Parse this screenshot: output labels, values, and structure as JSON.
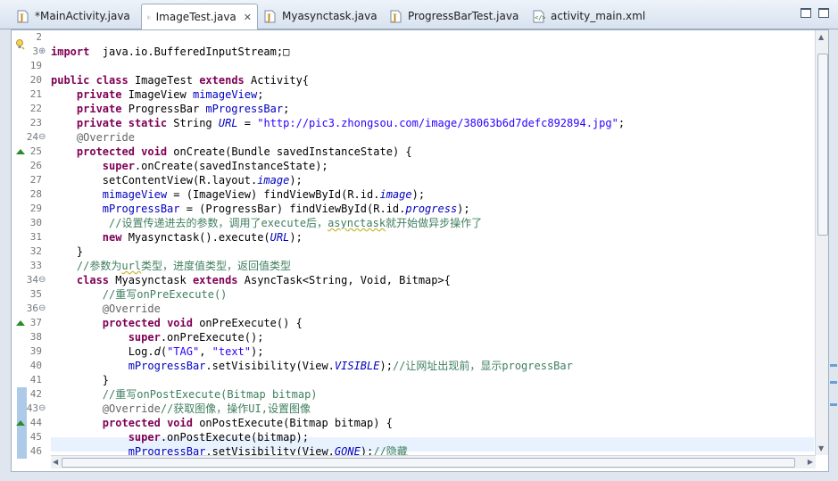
{
  "tabs": [
    {
      "label": "*MainActivity.java",
      "icon": "java-file-icon",
      "active": false
    },
    {
      "label": "ImageTest.java",
      "icon": "java-file-icon",
      "active": true
    },
    {
      "label": "Myasynctask.java",
      "icon": "java-file-icon",
      "active": false
    },
    {
      "label": "ProgressBarTest.java",
      "icon": "java-file-icon",
      "active": false
    },
    {
      "label": "activity_main.xml",
      "icon": "xml-file-icon",
      "active": false
    }
  ],
  "gutter": {
    "line_numbers": [
      "2",
      "3",
      "19",
      "20",
      "21",
      "22",
      "23",
      "24",
      "25",
      "26",
      "27",
      "28",
      "29",
      "30",
      "31",
      "32",
      "33",
      "34",
      "35",
      "36",
      "37",
      "38",
      "39",
      "40",
      "41",
      "42",
      "43",
      "44",
      "45",
      "46"
    ]
  },
  "code_lines": [
    [],
    [
      [
        "kw",
        "import"
      ],
      [
        "",
        "  java.io.BufferedInputStream;"
      ],
      [
        "",
        "□"
      ]
    ],
    [],
    [
      [
        "kw",
        "public"
      ],
      [
        "",
        " "
      ],
      [
        "kw",
        "class"
      ],
      [
        "",
        " ImageTest "
      ],
      [
        "kw",
        "extends"
      ],
      [
        "",
        " Activity{"
      ]
    ],
    [
      [
        "",
        "    "
      ],
      [
        "kw",
        "private"
      ],
      [
        "",
        " ImageView "
      ],
      [
        "fld",
        "mimageView"
      ],
      [
        "",
        ";"
      ]
    ],
    [
      [
        "",
        "    "
      ],
      [
        "kw",
        "private"
      ],
      [
        "",
        " ProgressBar "
      ],
      [
        "fld",
        "mProgressBar"
      ],
      [
        "",
        ";"
      ]
    ],
    [
      [
        "",
        "    "
      ],
      [
        "kw",
        "private"
      ],
      [
        "",
        " "
      ],
      [
        "kw",
        "static"
      ],
      [
        "",
        " String "
      ],
      [
        "ifld",
        "URL"
      ],
      [
        "",
        " = "
      ],
      [
        "str",
        "\"http://pic3.zhongsou.com/image/38063b6d7defc892894.jpg\""
      ],
      [
        "",
        ";"
      ]
    ],
    [
      [
        "",
        "    "
      ],
      [
        "ann",
        "@Override"
      ]
    ],
    [
      [
        "",
        "    "
      ],
      [
        "kw",
        "protected"
      ],
      [
        "",
        " "
      ],
      [
        "kw",
        "void"
      ],
      [
        "",
        " onCreate(Bundle savedInstanceState) {"
      ]
    ],
    [
      [
        "",
        "        "
      ],
      [
        "kw",
        "super"
      ],
      [
        "",
        ".onCreate(savedInstanceState);"
      ]
    ],
    [
      [
        "",
        "        setContentView(R.layout."
      ],
      [
        "ifld",
        "image"
      ],
      [
        "",
        ");"
      ]
    ],
    [
      [
        "",
        "        "
      ],
      [
        "fld",
        "mimageView"
      ],
      [
        "",
        " = (ImageView) findViewById(R.id."
      ],
      [
        "ifld",
        "image"
      ],
      [
        "",
        ");"
      ]
    ],
    [
      [
        "",
        "        "
      ],
      [
        "fld",
        "mProgressBar"
      ],
      [
        "",
        " = (ProgressBar) findViewById(R.id."
      ],
      [
        "ifld",
        "progress"
      ],
      [
        "",
        ");"
      ]
    ],
    [
      [
        "",
        "         "
      ],
      [
        "cmt",
        "//设置传递进去的参数，调用了execute后，"
      ],
      [
        "cmtsq",
        "asynctask"
      ],
      [
        "cmt",
        "就开始做异步操作了"
      ]
    ],
    [
      [
        "",
        "        "
      ],
      [
        "kw",
        "new"
      ],
      [
        "",
        " Myasynctask().execute("
      ],
      [
        "ifld",
        "URL"
      ],
      [
        "",
        ");"
      ]
    ],
    [
      [
        "",
        "    }"
      ]
    ],
    [
      [
        "",
        "    "
      ],
      [
        "cmt",
        "//参数为"
      ],
      [
        "cmtsq",
        "url"
      ],
      [
        "cmt",
        "类型，进度值类型，返回值类型"
      ]
    ],
    [
      [
        "",
        "    "
      ],
      [
        "kw",
        "class"
      ],
      [
        "",
        " Myasynctask "
      ],
      [
        "kw",
        "extends"
      ],
      [
        "",
        " AsyncTask<String, Void, Bitmap>{"
      ]
    ],
    [
      [
        "",
        "        "
      ],
      [
        "cmt",
        "//重写onPreExecute()"
      ]
    ],
    [
      [
        "",
        "        "
      ],
      [
        "ann",
        "@Override"
      ]
    ],
    [
      [
        "",
        "        "
      ],
      [
        "kw",
        "protected"
      ],
      [
        "",
        " "
      ],
      [
        "kw",
        "void"
      ],
      [
        "",
        " onPreExecute() {"
      ]
    ],
    [
      [
        "",
        "            "
      ],
      [
        "kw",
        "super"
      ],
      [
        "",
        ".onPreExecute();"
      ]
    ],
    [
      [
        "",
        "            Log."
      ],
      [
        "it",
        "d"
      ],
      [
        "",
        "("
      ],
      [
        "str",
        "\"TAG\""
      ],
      [
        "",
        ", "
      ],
      [
        "str",
        "\"text\""
      ],
      [
        "",
        ");"
      ]
    ],
    [
      [
        "",
        "            "
      ],
      [
        "fld",
        "mProgressBar"
      ],
      [
        "",
        ".setVisibility(View."
      ],
      [
        "ifld",
        "VISIBLE"
      ],
      [
        "",
        ");"
      ],
      [
        "cmt",
        "//让网址出现前，显示progressBar"
      ]
    ],
    [
      [
        "",
        "        }"
      ]
    ],
    [
      [
        "",
        "        "
      ],
      [
        "cmt",
        "//重写onPostExecute(Bitmap bitmap)"
      ]
    ],
    [
      [
        "",
        "        "
      ],
      [
        "ann",
        "@Override"
      ],
      [
        "cmt",
        "//获取图像，操作UI,设置图像"
      ]
    ],
    [
      [
        "",
        "        "
      ],
      [
        "kw",
        "protected"
      ],
      [
        "",
        " "
      ],
      [
        "kw",
        "void"
      ],
      [
        "",
        " onPostExecute(Bitmap bitmap) {"
      ]
    ],
    [
      [
        "",
        "            "
      ],
      [
        "kw",
        "super"
      ],
      [
        "",
        ".onPostExecute(bitmap);"
      ]
    ],
    [
      [
        "",
        "            "
      ],
      [
        "fld",
        "mProgressBar"
      ],
      [
        "",
        ".setVisibility(View."
      ],
      [
        "ifld",
        "GONE"
      ],
      [
        "",
        ");"
      ],
      [
        "cmt",
        "//隐藏"
      ]
    ]
  ],
  "colors": {
    "keyword": "#7f0055",
    "field": "#0000c0",
    "string": "#2a00ff",
    "comment": "#3f7f5f",
    "annotation": "#646464",
    "current_line": "#e8f2fe"
  }
}
